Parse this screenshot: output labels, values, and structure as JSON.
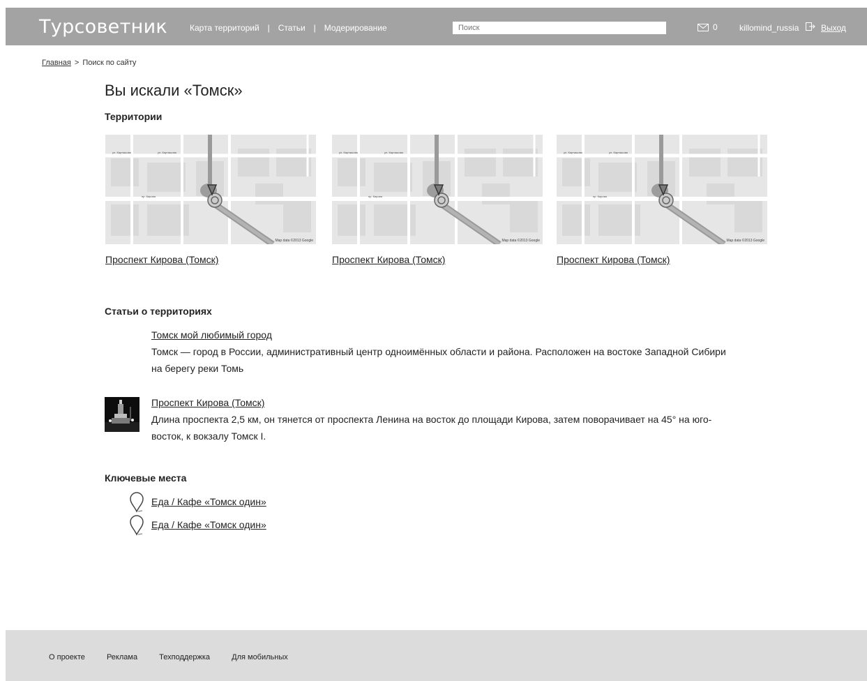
{
  "header": {
    "logo": "Турсоветник",
    "nav": [
      "Карта территорий",
      "Статьи",
      "Модерирование"
    ],
    "nav_separator": "|",
    "search_placeholder": "Поиск",
    "mail_count": "0",
    "username": "killomind_russia",
    "logout": "Выход"
  },
  "breadcrumb": {
    "home": "Главная",
    "separator": ">",
    "current": "Поиск по сайту"
  },
  "page_title": "Вы искали «Томск»",
  "territories": {
    "title": "Территории",
    "items": [
      {
        "label": "Проспект Кирова (Томск)"
      },
      {
        "label": "Проспект Кирова (Томск)"
      },
      {
        "label": "Проспект Кирова (Томск)"
      }
    ],
    "map_attribution": "Map data ©2013 Google"
  },
  "articles": {
    "title": "Статьи о территориях",
    "items": [
      {
        "title": "Томск мой любимый город",
        "desc": "Томск — город в России, административный центр одноимённых области и района. Расположен на востоке Западной Сибири на берегу реки Томь"
      },
      {
        "title": "Проспект Кирова (Томск)",
        "desc": "Длина проспекта 2,5 км, он тянется от проспекта Ленина на восток до площади Кирова, затем поворачивает на 45° на юго-восток, к вокзалу Томск I."
      }
    ]
  },
  "places": {
    "title": "Ключевые места",
    "items": [
      {
        "label": "Еда / Кафе «Томск один»"
      },
      {
        "label": "Еда / Кафе «Томск один»"
      }
    ]
  },
  "footer": {
    "links": [
      "О проекте",
      "Реклама",
      "Техподдержка",
      "Для мобильных"
    ]
  },
  "colors": {
    "header_bg": "#a3a3a3",
    "footer_bg": "#dcdcdc"
  }
}
